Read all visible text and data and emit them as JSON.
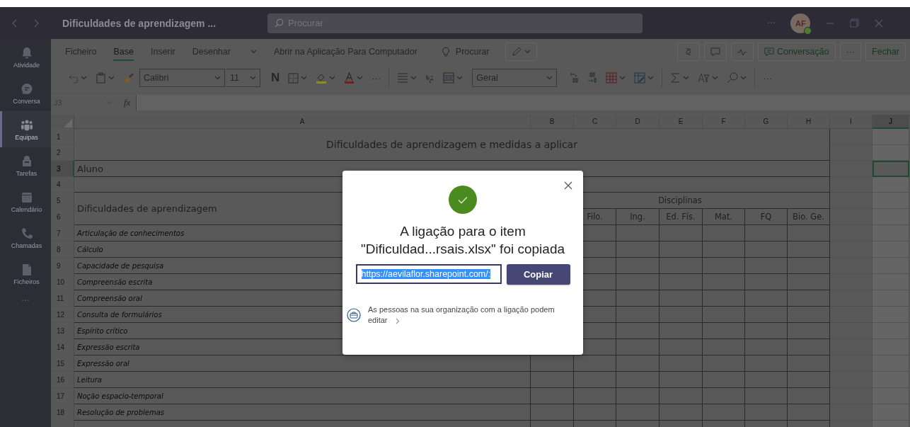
{
  "title_bar": {
    "title": "Dificuldades de aprendizagem ...",
    "search": {
      "placeholder": "Procurar"
    },
    "more": "···",
    "avatar": {
      "initials": "AF"
    }
  },
  "rail": {
    "items": [
      {
        "label": "Atividade",
        "selected": false
      },
      {
        "label": "Conversa",
        "selected": false
      },
      {
        "label": "Equipas",
        "selected": true
      },
      {
        "label": "Tarefas",
        "selected": false
      },
      {
        "label": "Calendário",
        "selected": false
      },
      {
        "label": "Chamadas",
        "selected": false
      },
      {
        "label": "Ficheiros",
        "selected": false
      }
    ],
    "more": "···"
  },
  "ribbon": {
    "tabs": [
      {
        "label": "Ficheiro",
        "selected": false
      },
      {
        "label": "Base",
        "selected": true
      },
      {
        "label": "Inserir",
        "selected": false
      },
      {
        "label": "Desenhar",
        "selected": false
      }
    ],
    "open_desktop": "Abrir na Aplicação Para Computador",
    "search": "Procurar",
    "conversation": "Conversação",
    "more": "···",
    "close": "Fechar"
  },
  "toolbar": {
    "font": "Calibri",
    "font_size": "11",
    "bold": "N",
    "overflow_1": "···",
    "number_format": "Geral",
    "overflow_2": "···"
  },
  "formula_bar": {
    "name_box": "J3",
    "function_label": "fx"
  },
  "sheet": {
    "columns": [
      {
        "label": "A",
        "selected": false
      },
      {
        "label": "B",
        "selected": false
      },
      {
        "label": "C",
        "selected": false
      },
      {
        "label": "D",
        "selected": false
      },
      {
        "label": "E",
        "selected": false
      },
      {
        "label": "F",
        "selected": false
      },
      {
        "label": "G",
        "selected": false
      },
      {
        "label": "H",
        "selected": false
      },
      {
        "label": "I",
        "selected": false
      },
      {
        "label": "J",
        "selected": true
      }
    ],
    "row_numbers": [
      {
        "number": "1",
        "selected": false
      },
      {
        "number": "2",
        "selected": false
      },
      {
        "number": "3",
        "selected": true
      },
      {
        "number": "4",
        "selected": false
      },
      {
        "number": "5",
        "selected": false
      },
      {
        "number": "6",
        "selected": false
      },
      {
        "number": "7",
        "selected": false
      },
      {
        "number": "8",
        "selected": false
      },
      {
        "number": "9",
        "selected": false
      },
      {
        "number": "10",
        "selected": false
      },
      {
        "number": "11",
        "selected": false
      },
      {
        "number": "12",
        "selected": false
      },
      {
        "number": "13",
        "selected": false
      },
      {
        "number": "14",
        "selected": false
      },
      {
        "number": "15",
        "selected": false
      },
      {
        "number": "16",
        "selected": false
      },
      {
        "number": "17",
        "selected": false
      },
      {
        "number": "18",
        "selected": false
      }
    ],
    "title": "Dificuldades de aprendizagem e medidas a aplicar",
    "student_label": "Aluno",
    "difficulties_header": "Dificuldades de aprendizagem",
    "subjects_header": "Disciplinas",
    "subjects": [
      "Filo.",
      "Ing.",
      "Ed. Fís.",
      "Mat.",
      "FQ",
      "Bio. Ge."
    ],
    "difficulties": [
      "Articulação de conhecimentos",
      "Cálculo",
      "Capacidade de pesquisa",
      "Compreensão escrita",
      "Compreensão oral",
      "Consulta de formulários",
      "Espírito crítico",
      "Expressão escrita",
      "Expressão oral",
      "Leitura",
      "Noção espacio-temporal",
      "Resolução de problemas"
    ]
  },
  "dialog": {
    "message": "A ligação para o item\n\"Dificuldad...rsais.xlsx\" foi copiada",
    "url": {
      "value": "https://aevilaflor.sharepoint.com/:",
      "selected": true
    },
    "copy_button": "Copiar",
    "permission_note": "As pessoas na sua organização com a ligação podem editar"
  }
}
